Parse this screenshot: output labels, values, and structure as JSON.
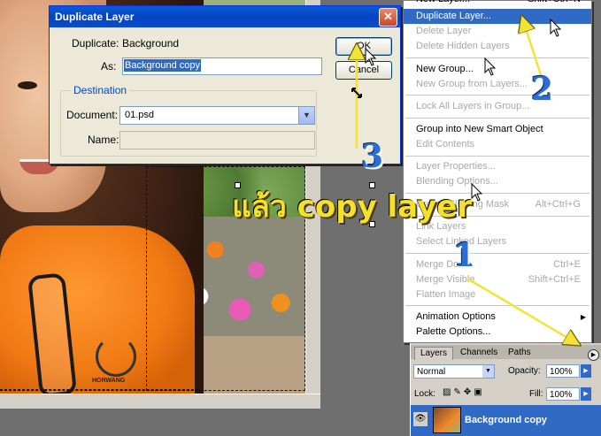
{
  "dialog": {
    "title": "Duplicate Layer",
    "duplicate_label": "Duplicate:",
    "duplicate_value": "Background",
    "as_label": "As:",
    "as_value": "Background copy",
    "destination_label": "Destination",
    "document_label": "Document:",
    "document_value": "01.psd",
    "name_label": "Name:",
    "name_value": "",
    "ok_label": "OK",
    "cancel_label": "Cancel"
  },
  "menu": {
    "items": [
      {
        "label": "New Layer...",
        "shortcut": "Shift+Ctrl+N",
        "state": "enabled"
      },
      {
        "label": "Duplicate Layer...",
        "shortcut": "",
        "state": "selected"
      },
      {
        "label": "Delete Layer",
        "shortcut": "",
        "state": "disabled"
      },
      {
        "label": "Delete Hidden Layers",
        "shortcut": "",
        "state": "disabled"
      },
      {
        "label": "New Group...",
        "shortcut": "",
        "state": "enabled"
      },
      {
        "label": "New Group from Layers...",
        "shortcut": "",
        "state": "disabled"
      },
      {
        "label": "Lock All Layers in Group...",
        "shortcut": "",
        "state": "disabled"
      },
      {
        "label": "Group into New Smart Object",
        "shortcut": "",
        "state": "enabled"
      },
      {
        "label": "Edit Contents",
        "shortcut": "",
        "state": "disabled"
      },
      {
        "label": "Layer Properties...",
        "shortcut": "",
        "state": "disabled"
      },
      {
        "label": "Blending Options...",
        "shortcut": "",
        "state": "disabled"
      },
      {
        "label": "Create Clipping Mask",
        "shortcut": "Alt+Ctrl+G",
        "state": "disabled"
      },
      {
        "label": "Link Layers",
        "shortcut": "",
        "state": "disabled"
      },
      {
        "label": "Select Linked Layers",
        "shortcut": "",
        "state": "disabled"
      },
      {
        "label": "Merge Down",
        "shortcut": "Ctrl+E",
        "state": "disabled"
      },
      {
        "label": "Merge Visible",
        "shortcut": "Shift+Ctrl+E",
        "state": "disabled"
      },
      {
        "label": "Flatten Image",
        "shortcut": "",
        "state": "disabled"
      },
      {
        "label": "Animation Options",
        "shortcut": "",
        "state": "enabled"
      },
      {
        "label": "Palette Options...",
        "shortcut": "",
        "state": "enabled"
      }
    ]
  },
  "panel": {
    "tabs": [
      "Layers",
      "Channels",
      "Paths"
    ],
    "blend_mode": "Normal",
    "opacity_label": "Opacity:",
    "opacity_value": "100%",
    "lock_label": "Lock:",
    "fill_label": "Fill:",
    "fill_value": "100%",
    "layer_name": "Background copy"
  },
  "annotations": {
    "step1": "1",
    "step2": "2",
    "step3": "3",
    "caption": "แล้ว copy layer",
    "arrow_color": "#f2e437",
    "number_color": "#2a6fd8"
  },
  "photo": {
    "shirt_text": "HORWANG"
  }
}
